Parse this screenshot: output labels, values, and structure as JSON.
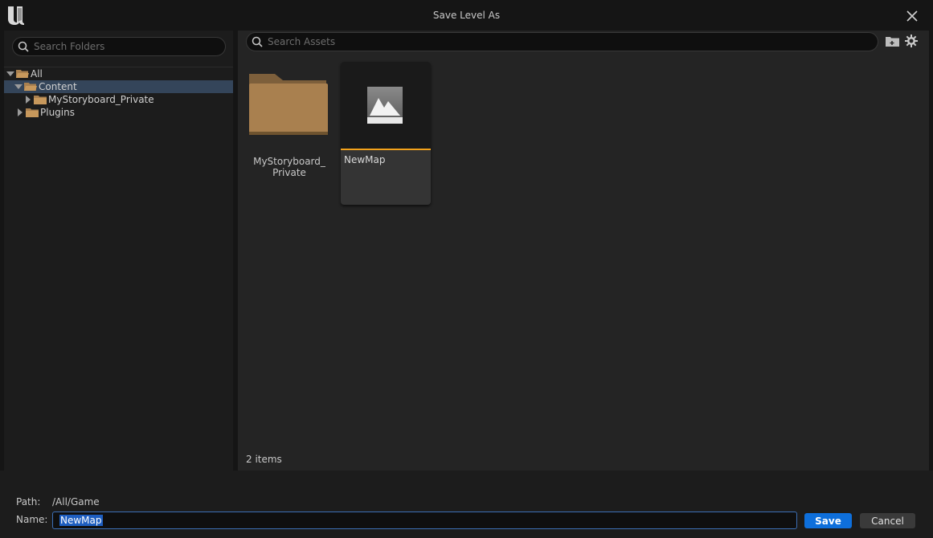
{
  "window": {
    "title": "Save Level As"
  },
  "left_panel": {
    "search_placeholder": "Search Folders",
    "tree": [
      {
        "label": "All",
        "expanded": true
      },
      {
        "label": "Content",
        "expanded": true,
        "selected": true
      },
      {
        "label": "MyStoryboard_Private",
        "expanded": false
      },
      {
        "label": "Plugins",
        "expanded": false
      }
    ]
  },
  "right_panel": {
    "search_placeholder": "Search Assets",
    "items": [
      {
        "kind": "folder",
        "name_line1": "MyStoryboard_",
        "name_line2": "Private"
      },
      {
        "kind": "asset",
        "name": "NewMap",
        "type": "Level"
      }
    ],
    "item_count": "2 items"
  },
  "footer": {
    "path_label": "Path:",
    "path_value": "/All/Game",
    "name_label": "Name:",
    "name_value": "NewMap",
    "save_label": "Save",
    "cancel_label": "Cancel"
  },
  "colors": {
    "accent_blue": "#0e6fdb",
    "asset_accent": "#f3a21b",
    "folder": "#a9804f",
    "selection": "#34455a"
  },
  "icons": {
    "logo": "unreal-logo-icon",
    "close": "close-icon",
    "search": "search-icon",
    "new_folder": "add-folder-icon",
    "settings": "gear-icon",
    "level": "level-mountain-icon"
  }
}
